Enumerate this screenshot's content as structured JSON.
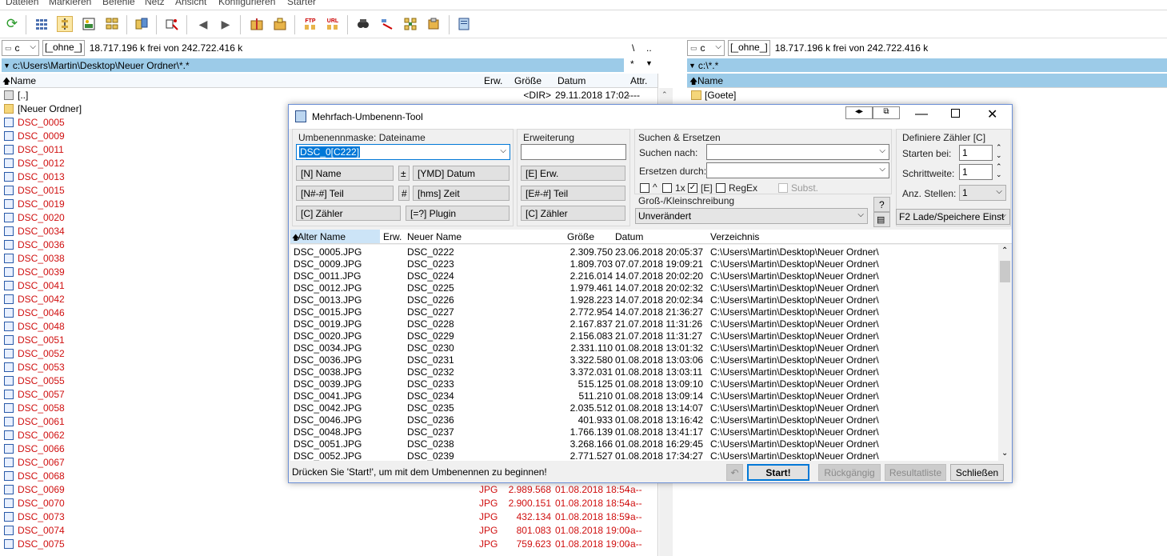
{
  "menu": [
    "Dateien",
    "Markieren",
    "Befehle",
    "Netz",
    "Ansicht",
    "Konfigurieren",
    "Starter"
  ],
  "toolbar_icons": [
    "refresh-icon",
    "thumbnails-icon",
    "tree-icon",
    "image-icon",
    "sync-icon",
    "compare-icon",
    "multirename-icon",
    "back-icon",
    "forward-icon",
    "pack-icon",
    "unpack-icon",
    "ftp-icon",
    "url-icon",
    "search-icon",
    "tool-icon",
    "settings-icon",
    "edit-icon",
    "notepad-icon"
  ],
  "left_panel": {
    "drive": "c",
    "drive_label": "[_ohne_]",
    "free_text": "18.717.196 k frei von 242.722.416 k",
    "root_btn": "\\",
    "up_btn": "..",
    "path": "c:\\Users\\Martin\\Desktop\\Neuer Ordner\\*.*",
    "star": "*",
    "columns": {
      "name": "Name",
      "ext": "Erw.",
      "size": "Größe",
      "date": "Datum",
      "attr": "Attr."
    },
    "files": [
      {
        "name": "[..]",
        "ext": "",
        "size": "<DIR>",
        "date": "29.11.2018 17:02",
        "attr": "----",
        "type": "up"
      },
      {
        "name": "[Neuer Ordner]",
        "ext": "",
        "size": "",
        "date": "",
        "attr": "",
        "type": "folder"
      },
      {
        "name": "DSC_0005",
        "type": "file"
      },
      {
        "name": "DSC_0009",
        "type": "file"
      },
      {
        "name": "DSC_0011",
        "type": "file"
      },
      {
        "name": "DSC_0012",
        "type": "file"
      },
      {
        "name": "DSC_0013",
        "type": "file"
      },
      {
        "name": "DSC_0015",
        "type": "file"
      },
      {
        "name": "DSC_0019",
        "type": "file"
      },
      {
        "name": "DSC_0020",
        "type": "file"
      },
      {
        "name": "DSC_0034",
        "type": "file"
      },
      {
        "name": "DSC_0036",
        "type": "file"
      },
      {
        "name": "DSC_0038",
        "type": "file"
      },
      {
        "name": "DSC_0039",
        "type": "file"
      },
      {
        "name": "DSC_0041",
        "type": "file"
      },
      {
        "name": "DSC_0042",
        "type": "file"
      },
      {
        "name": "DSC_0046",
        "type": "file"
      },
      {
        "name": "DSC_0048",
        "type": "file"
      },
      {
        "name": "DSC_0051",
        "type": "file"
      },
      {
        "name": "DSC_0052",
        "type": "file"
      },
      {
        "name": "DSC_0053",
        "type": "file"
      },
      {
        "name": "DSC_0055",
        "type": "file"
      },
      {
        "name": "DSC_0057",
        "type": "file"
      },
      {
        "name": "DSC_0058",
        "type": "file"
      },
      {
        "name": "DSC_0061",
        "type": "file"
      },
      {
        "name": "DSC_0062",
        "type": "file"
      },
      {
        "name": "DSC_0066",
        "type": "file"
      },
      {
        "name": "DSC_0067",
        "type": "file"
      },
      {
        "name": "DSC_0068",
        "type": "file"
      },
      {
        "name": "DSC_0069",
        "ext": "JPG",
        "size": "2.989.568",
        "date": "01.08.2018 18:54",
        "attr": "-a--",
        "type": "file"
      },
      {
        "name": "DSC_0070",
        "ext": "JPG",
        "size": "2.900.151",
        "date": "01.08.2018 18:54",
        "attr": "-a--",
        "type": "file"
      },
      {
        "name": "DSC_0073",
        "ext": "JPG",
        "size": "432.134",
        "date": "01.08.2018 18:59",
        "attr": "-a--",
        "type": "file"
      },
      {
        "name": "DSC_0074",
        "ext": "JPG",
        "size": "801.083",
        "date": "01.08.2018 19:00",
        "attr": "-a--",
        "type": "file"
      },
      {
        "name": "DSC_0075",
        "ext": "JPG",
        "size": "759.623",
        "date": "01.08.2018 19:00",
        "attr": "-a--",
        "type": "file"
      }
    ]
  },
  "right_panel": {
    "drive": "c",
    "drive_label": "[_ohne_]",
    "free_text": "18.717.196 k frei von 242.722.416 k",
    "path": "c:\\*.*",
    "col_name": "Name",
    "first_item": "[Goete]"
  },
  "dialog": {
    "title": "Mehrfach-Umbenenn-Tool",
    "mask_label": "Umbenennmaske: Dateiname",
    "mask_value": "DSC_0[C222]",
    "ext_label": "Erweiterung",
    "ext_value": "",
    "btn_name": "[N]  Name",
    "btn_plus": "±",
    "btn_ymd": "[YMD]  Datum",
    "btn_ndt": "[N#-#] Teil",
    "btn_hash": "#",
    "btn_hms": "[hms]  Zeit",
    "btn_counter": "[C]  Zähler",
    "btn_plugin": "[=?]  Plugin",
    "btn_e_ext": "[E]  Erw.",
    "btn_e_part": "[E#-#] Teil",
    "btn_e_counter": "[C]  Zähler",
    "search_group": "Suchen & Ersetzen",
    "search_label": "Suchen nach:",
    "replace_label": "Ersetzen durch:",
    "opt_caret": "^",
    "opt_1x": "1x",
    "opt_e": "[E]",
    "opt_regex": "RegEx",
    "opt_subst": "Subst.",
    "case_label": "Groß-/Kleinschreibung",
    "case_value": "Unverändert",
    "help_btn": "?",
    "counter_group": "Definiere Zähler [C]",
    "start_label": "Starten bei:",
    "start_value": "1",
    "step_label": "Schrittweite:",
    "step_value": "1",
    "digits_label": "Anz. Stellen:",
    "digits_value": "1",
    "load_save": "F2 Lade/Speichere Einst",
    "columns": {
      "old": "Alter Name",
      "ext": "Erw.",
      "new": "Neuer Name",
      "size": "Größe",
      "date": "Datum",
      "dir": "Verzeichnis"
    },
    "rows": [
      {
        "old": "DSC_0005.JPG",
        "new": "DSC_0222",
        "size": "2.309.750",
        "date": "23.06.2018 20:05:37",
        "dir": "C:\\Users\\Martin\\Desktop\\Neuer Ordner\\"
      },
      {
        "old": "DSC_0009.JPG",
        "new": "DSC_0223",
        "size": "1.809.703",
        "date": "07.07.2018 19:09:21",
        "dir": "C:\\Users\\Martin\\Desktop\\Neuer Ordner\\"
      },
      {
        "old": "DSC_0011.JPG",
        "new": "DSC_0224",
        "size": "2.216.014",
        "date": "14.07.2018 20:02:20",
        "dir": "C:\\Users\\Martin\\Desktop\\Neuer Ordner\\"
      },
      {
        "old": "DSC_0012.JPG",
        "new": "DSC_0225",
        "size": "1.979.461",
        "date": "14.07.2018 20:02:32",
        "dir": "C:\\Users\\Martin\\Desktop\\Neuer Ordner\\"
      },
      {
        "old": "DSC_0013.JPG",
        "new": "DSC_0226",
        "size": "1.928.223",
        "date": "14.07.2018 20:02:34",
        "dir": "C:\\Users\\Martin\\Desktop\\Neuer Ordner\\"
      },
      {
        "old": "DSC_0015.JPG",
        "new": "DSC_0227",
        "size": "2.772.954",
        "date": "14.07.2018 21:36:27",
        "dir": "C:\\Users\\Martin\\Desktop\\Neuer Ordner\\"
      },
      {
        "old": "DSC_0019.JPG",
        "new": "DSC_0228",
        "size": "2.167.837",
        "date": "21.07.2018 11:31:26",
        "dir": "C:\\Users\\Martin\\Desktop\\Neuer Ordner\\"
      },
      {
        "old": "DSC_0020.JPG",
        "new": "DSC_0229",
        "size": "2.156.083",
        "date": "21.07.2018 11:31:27",
        "dir": "C:\\Users\\Martin\\Desktop\\Neuer Ordner\\"
      },
      {
        "old": "DSC_0034.JPG",
        "new": "DSC_0230",
        "size": "2.331.110",
        "date": "01.08.2018 13:01:32",
        "dir": "C:\\Users\\Martin\\Desktop\\Neuer Ordner\\"
      },
      {
        "old": "DSC_0036.JPG",
        "new": "DSC_0231",
        "size": "3.322.580",
        "date": "01.08.2018 13:03:06",
        "dir": "C:\\Users\\Martin\\Desktop\\Neuer Ordner\\"
      },
      {
        "old": "DSC_0038.JPG",
        "new": "DSC_0232",
        "size": "3.372.031",
        "date": "01.08.2018 13:03:11",
        "dir": "C:\\Users\\Martin\\Desktop\\Neuer Ordner\\"
      },
      {
        "old": "DSC_0039.JPG",
        "new": "DSC_0233",
        "size": "515.125",
        "date": "01.08.2018 13:09:10",
        "dir": "C:\\Users\\Martin\\Desktop\\Neuer Ordner\\"
      },
      {
        "old": "DSC_0041.JPG",
        "new": "DSC_0234",
        "size": "511.210",
        "date": "01.08.2018 13:09:14",
        "dir": "C:\\Users\\Martin\\Desktop\\Neuer Ordner\\"
      },
      {
        "old": "DSC_0042.JPG",
        "new": "DSC_0235",
        "size": "2.035.512",
        "date": "01.08.2018 13:14:07",
        "dir": "C:\\Users\\Martin\\Desktop\\Neuer Ordner\\"
      },
      {
        "old": "DSC_0046.JPG",
        "new": "DSC_0236",
        "size": "401.933",
        "date": "01.08.2018 13:16:42",
        "dir": "C:\\Users\\Martin\\Desktop\\Neuer Ordner\\"
      },
      {
        "old": "DSC_0048.JPG",
        "new": "DSC_0237",
        "size": "1.766.139",
        "date": "01.08.2018 13:41:17",
        "dir": "C:\\Users\\Martin\\Desktop\\Neuer Ordner\\"
      },
      {
        "old": "DSC_0051.JPG",
        "new": "DSC_0238",
        "size": "3.268.166",
        "date": "01.08.2018 16:29:45",
        "dir": "C:\\Users\\Martin\\Desktop\\Neuer Ordner\\"
      },
      {
        "old": "DSC_0052.JPG",
        "new": "DSC_0239",
        "size": "2.771.527",
        "date": "01.08.2018 17:34:27",
        "dir": "C:\\Users\\Martin\\Desktop\\Neuer Ordner\\"
      }
    ],
    "status": "Drücken Sie 'Start!', um mit dem Umbenennen zu beginnen!",
    "btn_start": "Start!",
    "btn_undo": "Rückgängig",
    "btn_result": "Resultatliste",
    "btn_close": "Schließen"
  },
  "colors": {
    "path_bg": "#9ccbe8",
    "file_red": "#d01010",
    "start_border": "#0078d7"
  }
}
